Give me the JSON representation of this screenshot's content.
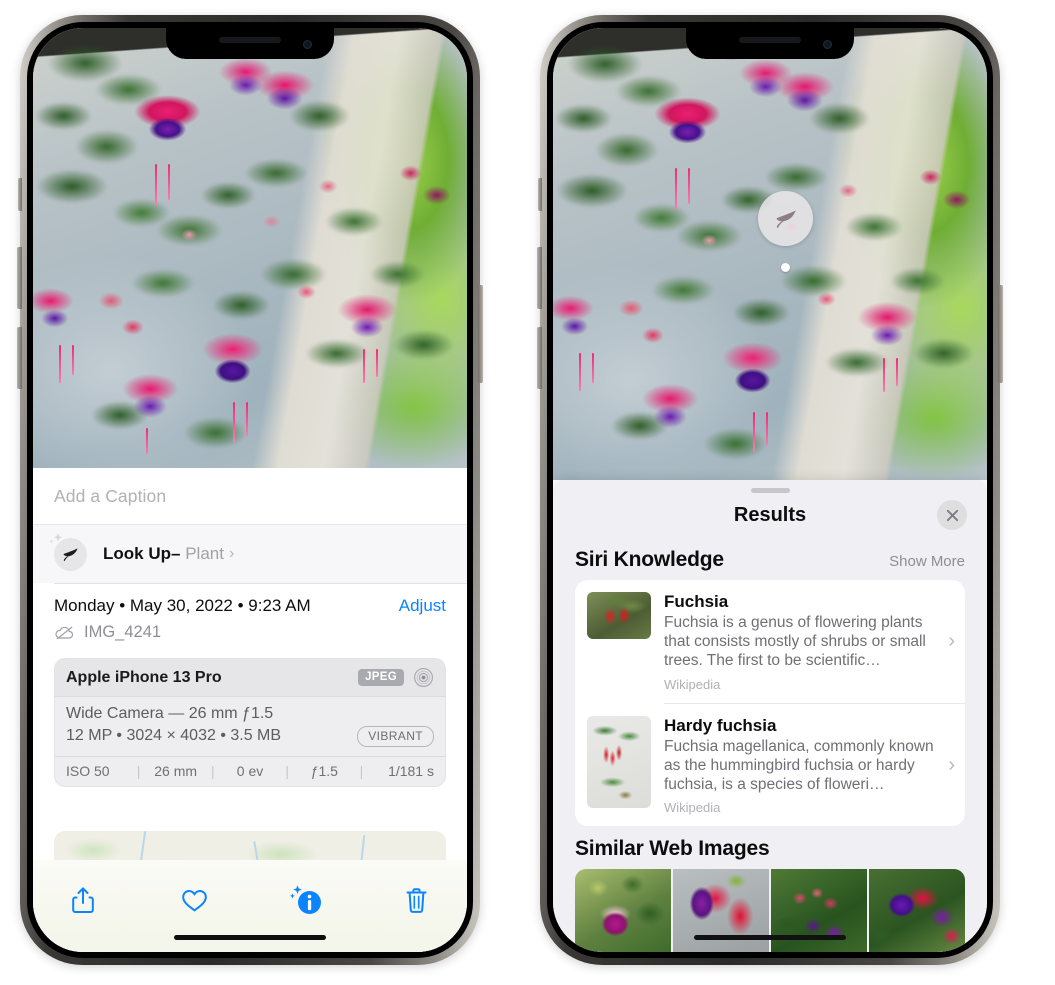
{
  "left_phone": {
    "name": "Photos app — photo info view",
    "photo": {
      "alt": "Fuchsia flowers hanging in a basket on a porch"
    },
    "caption": {
      "placeholder": "Add a Caption",
      "value": ""
    },
    "look_up": {
      "icon": "leaf-icon",
      "sparkle_icon": "sparkles-icon",
      "label": "Look Up",
      "separator": "–",
      "kind": "Plant",
      "chevron": "›"
    },
    "date_row": {
      "date_text": "Monday • May 30, 2022 • 9:23 AM",
      "adjust_label": "Adjust"
    },
    "file_row": {
      "icon": "icloud-slash-icon",
      "filename": "IMG_4241"
    },
    "exif": {
      "device": "Apple iPhone 13 Pro",
      "format_badge": "JPEG",
      "lens_icon": "aperture-icon",
      "lens_line": "Wide Camera — 26 mm ƒ1.5",
      "specs_line": "12 MP • 3024 × 4032 • 3.5 MB",
      "style_chip": "VIBRANT",
      "settings": [
        "ISO 50",
        "26 mm",
        "0 ev",
        "ƒ1.5",
        "1/181 s"
      ]
    },
    "map": {
      "name": "location-map",
      "pin": "photo-thumbnail-pin"
    },
    "toolbar": [
      {
        "name": "share-button",
        "icon": "share-icon"
      },
      {
        "name": "favorite-button",
        "icon": "heart-icon"
      },
      {
        "name": "info-button",
        "icon": "info-sparkle-icon"
      },
      {
        "name": "delete-button",
        "icon": "trash-icon"
      }
    ],
    "accent_color": "#0a84ff"
  },
  "right_phone": {
    "name": "Visual Look Up results sheet",
    "photo_badge": {
      "icon": "leaf-icon",
      "label": "plant-detected-badge"
    },
    "sheet": {
      "title": "Results",
      "close_icon": "close-icon",
      "grabber": "drag-handle"
    },
    "siri_knowledge": {
      "heading": "Siri Knowledge",
      "show_more": "Show More",
      "items": [
        {
          "title": "Fuchsia",
          "description": "Fuchsia is a genus of flowering plants that consists mostly of shrubs or small trees. The first to be scientific…",
          "source": "Wikipedia",
          "thumbnail": "fuchsia-red-flowers-thumbnail",
          "chevron": "›"
        },
        {
          "title": "Hardy fuchsia",
          "description": "Fuchsia magellanica, commonly known as the hummingbird fuchsia or hardy fuchsia, is a species of floweri…",
          "source": "Wikipedia",
          "thumbnail": "hardy-fuchsia-branch-thumbnail",
          "chevron": "›"
        }
      ]
    },
    "similar_web_images": {
      "heading": "Similar Web Images",
      "items": [
        "pink-white-fuchsia-thumbnail",
        "red-fuchsia-closeup-thumbnail",
        "fuchsia-bush-thumbnail",
        "purple-red-fuchsia-thumbnail"
      ]
    },
    "sheet_bg_color": "#efeff4"
  }
}
